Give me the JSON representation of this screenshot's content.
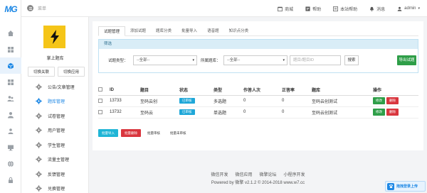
{
  "brand": {
    "logo_text": "MG"
  },
  "topbar": {
    "breadcrumb": "菜单",
    "nav": [
      {
        "label": "商城",
        "icon": "store-icon"
      },
      {
        "label": "帮助",
        "icon": "help-icon"
      },
      {
        "label": "本站帮助",
        "icon": "book-icon"
      },
      {
        "label": "消息",
        "icon": "bell-icon"
      },
      {
        "label": "admin",
        "icon": "user-icon"
      }
    ]
  },
  "subsidebar": {
    "shop_name": "掌上题库",
    "switch_button": "切换关联",
    "switch_app_button": "切换应用",
    "menu": [
      {
        "label": "公告/文章管理"
      },
      {
        "label": "题库管理"
      },
      {
        "label": "试卷管理"
      },
      {
        "label": "用户管理"
      },
      {
        "label": "学生管理"
      },
      {
        "label": "流量主管理"
      },
      {
        "label": "反馈管理"
      },
      {
        "label": "兑换管理"
      }
    ]
  },
  "tabs": [
    {
      "label": "试题管理"
    },
    {
      "label": "添加试题"
    },
    {
      "label": "题库分类"
    },
    {
      "label": "批量导入"
    },
    {
      "label": "语音题"
    },
    {
      "label": "知识点分类"
    }
  ],
  "filter": {
    "title": "筛选",
    "type_label": "试题类型：",
    "type_value": "--全部--",
    "bank_label": "所属题库：",
    "bank_value": "--全部--",
    "id_placeholder": "题目/题目ID",
    "search_button": "搜索",
    "export_button": "导出试题"
  },
  "table": {
    "headers": {
      "id": "ID",
      "title": "题目",
      "status": "状态",
      "type": "类型",
      "attempts": "作答人次",
      "accuracy": "正答率",
      "bank": "题库",
      "ops": "操作"
    },
    "rows": [
      {
        "id": "13733",
        "title": "至码云创",
        "status": "已审核",
        "type": "多选题",
        "attempts": "0",
        "accuracy": "0",
        "bank": "至码云创测试",
        "edit": "修改",
        "delete": "删除"
      },
      {
        "id": "13732",
        "title": "至码云",
        "status": "已审核",
        "type": "单选题",
        "attempts": "0",
        "accuracy": "0",
        "bank": "至码云创测试",
        "edit": "修改",
        "delete": "删除"
      }
    ]
  },
  "bulk_actions": {
    "import": "批量导入",
    "delete": "批量删除",
    "approve": "批量审核",
    "unapprove": "批量未审核"
  },
  "footer": {
    "links": [
      "微信开发",
      "微信应用",
      "微擎论坛",
      "小程序开发"
    ],
    "powered": "Powered by 微擎 v2.1.2 © 2014-2018 www.w7.cc"
  },
  "float_button": {
    "label": "拖拽登录上传"
  },
  "colors": {
    "accent": "#1e88e5",
    "green": "#2e9e48",
    "red": "#d9363e",
    "cyan": "#1fb5d6",
    "logo_bg": "#f5c518"
  }
}
